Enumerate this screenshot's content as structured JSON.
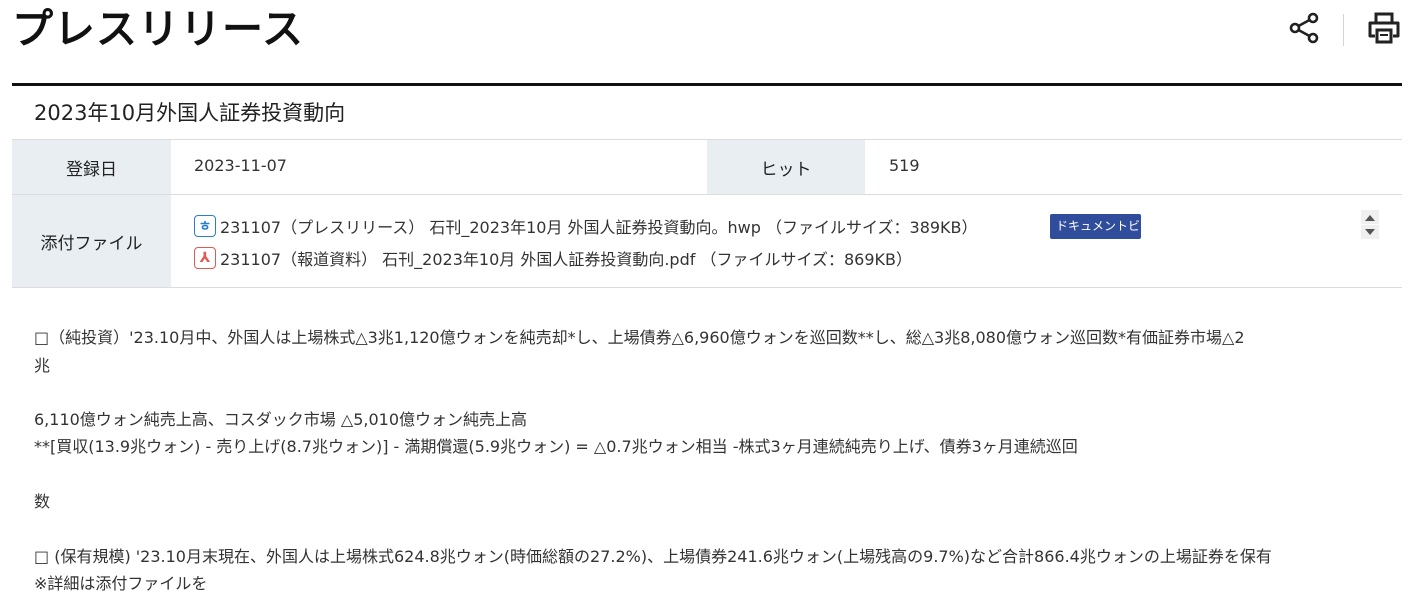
{
  "header": {
    "title": "プレスリリース",
    "share_icon": "share-icon",
    "print_icon": "print-icon"
  },
  "article": {
    "title": "2023年10月外国人証券投資動向",
    "registered_label": "登録日",
    "registered_date": "2023-11-07",
    "hits_label": "ヒット",
    "hits": "519",
    "attachments_label": "添付ファイル",
    "attachments": [
      {
        "icon": "hwp-file-icon",
        "icon_glyph": "ㅎ",
        "name": "231107（プレスリリース） 石刊_2023年10月 外国人証券投資動向。hwp （ファイルサイズ：389KB）",
        "viewer_label": "ドキュメントビューア"
      },
      {
        "icon": "pdf-file-icon",
        "icon_glyph": "⅄",
        "name": "231107（報道資料） 石刊_2023年10月 外国人証券投資動向.pdf （ファイルサイズ：869KB）"
      }
    ]
  },
  "body": {
    "lines": [
      "□（純投資）'23.10月中、外国人は上場株式△3兆1,120億ウォンを純売却*し、上場債券△6,960億ウォンを巡回数**し、総△3兆8,080億ウォン巡回数*有価証券市場△2",
      "兆",
      "6,110億ウォン純売上高、コスダック市場 △5,010億ウォン純売上高",
      "**[買収(13.9兆ウォン) - 売り上げ(8.7兆ウォン)] - 満期償還(5.9兆ウォン) = △0.7兆ウォン相当 -株式3ヶ月連続純売り上げ、債券3ヶ月連続巡回",
      "数",
      "□ (保有規模) '23.10月末現在、外国人は上場株式624.8兆ウォン(時価総額の27.2%)、上場債券241.6兆ウォン(上場残高の9.7%)など合計866.4兆ウォンの上場証券を保有",
      "※詳細は添付ファイルを"
    ]
  }
}
